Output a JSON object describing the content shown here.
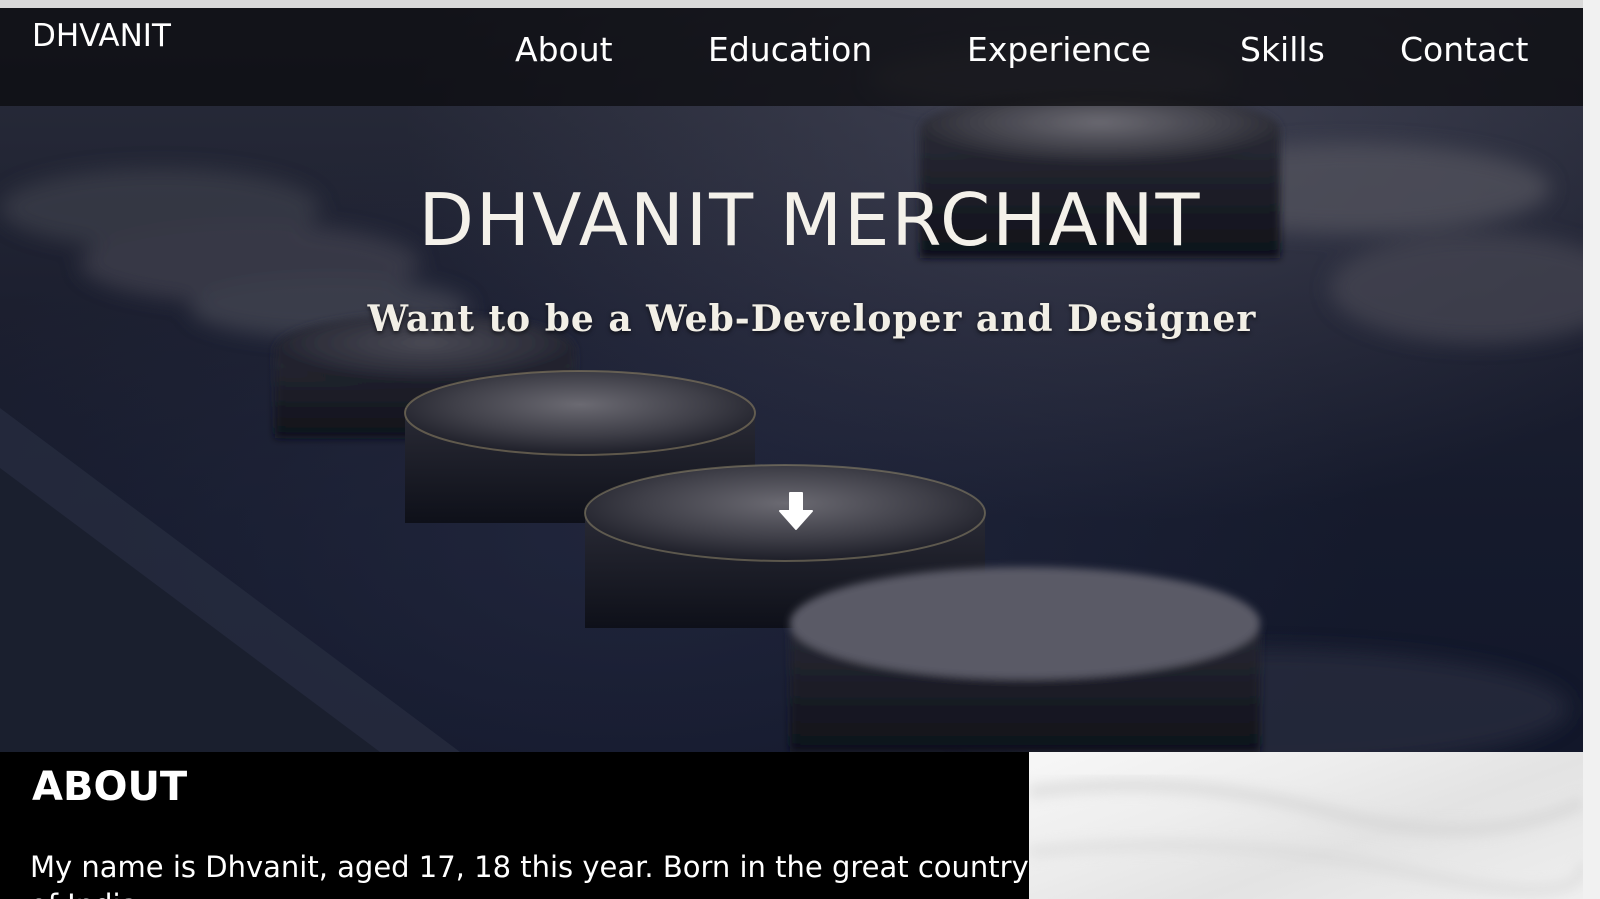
{
  "brand": "DHVANIT",
  "nav": {
    "items": [
      {
        "label": "About"
      },
      {
        "label": "Education"
      },
      {
        "label": "Experience"
      },
      {
        "label": "Skills"
      },
      {
        "label": "Contact"
      }
    ]
  },
  "hero": {
    "title": "DHVANIT MERCHANT",
    "subtitle": "Want to be a Web-Developer and Designer",
    "scroll_icon": "arrow-down-icon"
  },
  "about": {
    "heading": "ABOUT",
    "text_line1": "My name is Dhvanit, aged 17, 18 this year. Born in the great country",
    "text_line2": "of India"
  },
  "colors": {
    "nav_background": "#0a0a0c",
    "hero_text": "#f4f1ea",
    "about_background": "#000000",
    "about_image_background": "#ededed"
  }
}
